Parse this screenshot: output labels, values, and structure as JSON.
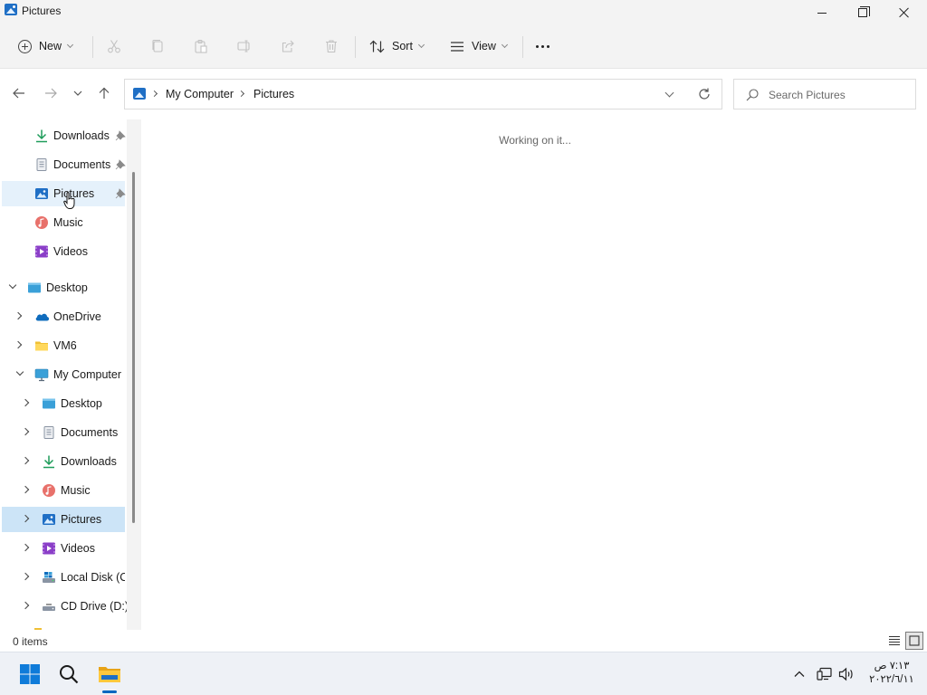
{
  "window": {
    "title": "Pictures"
  },
  "toolbar": {
    "new_label": "New",
    "sort_label": "Sort",
    "view_label": "View",
    "disabled_actions": [
      "cut",
      "copy",
      "paste",
      "rename",
      "share",
      "delete"
    ]
  },
  "address": {
    "crumbs": [
      "My Computer",
      "Pictures"
    ],
    "search_placeholder": "Search Pictures"
  },
  "sidebar": {
    "quick_access": [
      {
        "label": "Downloads",
        "icon": "download-icon",
        "pinned": true
      },
      {
        "label": "Documents",
        "icon": "document-icon",
        "pinned": true
      },
      {
        "label": "Pictures",
        "icon": "pictures-icon",
        "pinned": true,
        "hovered": true
      },
      {
        "label": "Music",
        "icon": "music-icon",
        "pinned": false
      },
      {
        "label": "Videos",
        "icon": "video-icon",
        "pinned": false
      }
    ],
    "tree": [
      {
        "label": "Desktop",
        "icon": "desktop-icon",
        "expanded": true
      },
      {
        "label": "OneDrive",
        "icon": "cloud-icon",
        "expanded": false
      },
      {
        "label": "VM6",
        "icon": "folder-icon",
        "expanded": false
      },
      {
        "label": "My Computer",
        "icon": "computer-icon",
        "expanded": true
      },
      {
        "label": "Desktop",
        "icon": "desktop-icon",
        "expanded": false
      },
      {
        "label": "Documents",
        "icon": "document-icon",
        "expanded": false
      },
      {
        "label": "Downloads",
        "icon": "download-icon",
        "expanded": false
      },
      {
        "label": "Music",
        "icon": "music-icon",
        "expanded": false
      },
      {
        "label": "Pictures",
        "icon": "pictures-icon",
        "expanded": false,
        "selected": true
      },
      {
        "label": "Videos",
        "icon": "video-icon",
        "expanded": false
      },
      {
        "label": "Local Disk (C:",
        "icon": "disk-icon",
        "expanded": false
      },
      {
        "label": "CD Drive (D:)",
        "icon": "cd-drive-icon",
        "expanded": false
      }
    ]
  },
  "content": {
    "status_message": "Working on it..."
  },
  "statusbar": {
    "item_count": "0 items"
  },
  "taskbar": {
    "time": "٧:١٣ ص",
    "date": "٢٠٢٢/٦/١١"
  },
  "colors": {
    "accent": "#0067c0",
    "selection": "#cce4f7",
    "hover": "#e5f1fb",
    "chrome": "#f3f3f3"
  }
}
